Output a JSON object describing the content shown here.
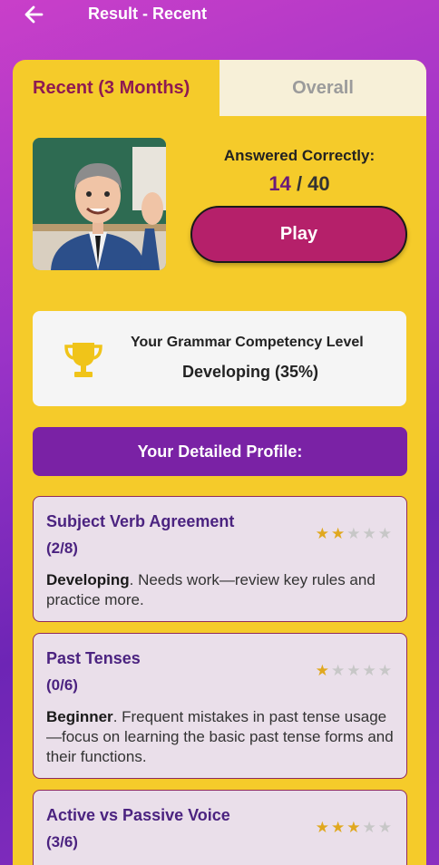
{
  "header": {
    "title": "Result - Recent"
  },
  "tabs": {
    "recent": "Recent (3 Months)",
    "overall": "Overall"
  },
  "result": {
    "answered_label": "Answered Correctly:",
    "correct": "14",
    "separator": " / ",
    "total": "40",
    "play_label": "Play"
  },
  "competency": {
    "title": "Your Grammar Competency Level",
    "value": "Developing (35%)"
  },
  "profile": {
    "header": "Your Detailed Profile:",
    "topics": [
      {
        "name": "Subject Verb Agreement",
        "score": "(2/8)",
        "stars": 2,
        "level": "Developing",
        "desc": ". Needs work—review key rules and practice more."
      },
      {
        "name": "Past Tenses",
        "score": "(0/6)",
        "stars": 1,
        "level": "Beginner",
        "desc": ". Frequent mistakes in past tense usage—focus on learning the basic past tense forms and their functions."
      },
      {
        "name": "Active vs Passive Voice",
        "score": "(3/6)",
        "stars": 3,
        "level": "",
        "desc": ""
      }
    ]
  },
  "colors": {
    "accent": "#b5206a",
    "card": "#f5cb2a",
    "profile_header": "#7a22a5",
    "star_on": "#e0a81f",
    "star_off": "#c7c7c7"
  },
  "icons": {
    "back": "arrow-left-icon",
    "trophy": "trophy-icon",
    "star": "star-icon"
  }
}
